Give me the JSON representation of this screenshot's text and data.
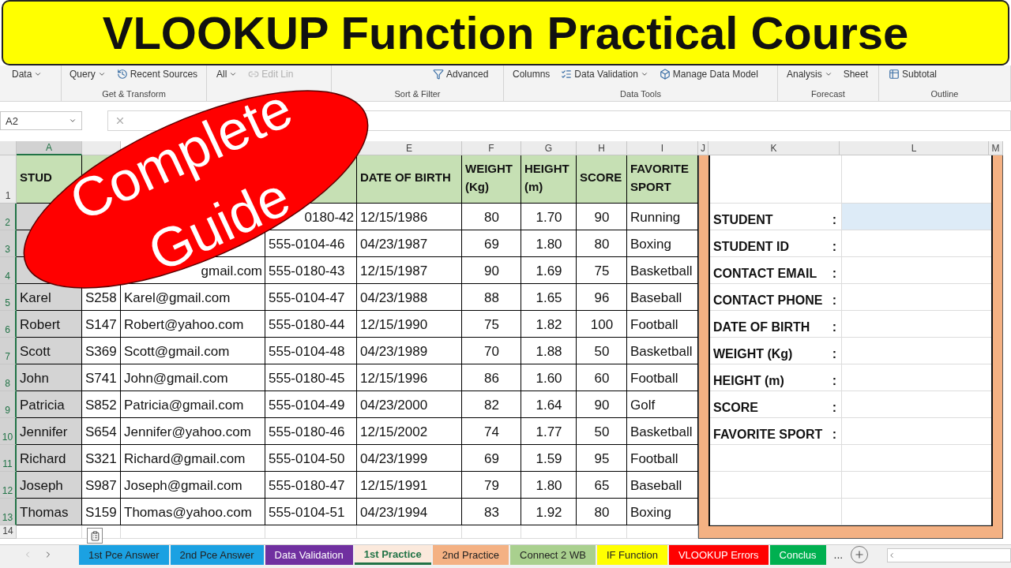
{
  "title": "VLOOKUP Function Practical Course",
  "ribbon": {
    "groups": [
      {
        "items": [
          {
            "label": "Data",
            "dropdown": true,
            "disabled": false
          }
        ]
      },
      {
        "label": "Get & Transform",
        "items": [
          {
            "label": "Query",
            "dropdown": true,
            "disabled": false
          },
          {
            "label": "Recent Sources",
            "dropdown": false,
            "disabled": false
          }
        ]
      },
      {
        "items": [
          {
            "label": "All",
            "dropdown": true,
            "disabled": false
          },
          {
            "label": "Edit Lin",
            "dropdown": false,
            "disabled": true
          }
        ]
      },
      {
        "label": "Sort & Filter",
        "items": [
          {
            "label": "Advanced",
            "dropdown": false,
            "disabled": false
          }
        ]
      },
      {
        "label": "Data Tools",
        "items": [
          {
            "label": "Columns",
            "dropdown": false,
            "disabled": false
          },
          {
            "label": "Data Validation",
            "dropdown": true,
            "disabled": false
          },
          {
            "label": "Manage Data Model",
            "dropdown": false,
            "disabled": false
          }
        ]
      },
      {
        "label": "Forecast",
        "items": [
          {
            "label": "Analysis",
            "dropdown": true,
            "disabled": false
          },
          {
            "label": "Sheet",
            "dropdown": false,
            "disabled": false
          }
        ]
      },
      {
        "label": "Outline",
        "items": [
          {
            "label": "Subtotal",
            "dropdown": false,
            "disabled": false
          }
        ]
      }
    ]
  },
  "name_box": "A2",
  "columns": [
    {
      "letter": "A",
      "selected": true
    },
    {
      "letter": "E",
      "selected": false
    },
    {
      "letter": "F",
      "selected": false
    },
    {
      "letter": "G",
      "selected": false
    },
    {
      "letter": "H",
      "selected": false
    },
    {
      "letter": "I",
      "selected": false
    },
    {
      "letter": "J",
      "selected": false
    },
    {
      "letter": "K",
      "selected": false
    },
    {
      "letter": "L",
      "selected": false
    },
    {
      "letter": "M",
      "selected": false
    }
  ],
  "rows": [
    {
      "number": "1",
      "selected": false,
      "cells": [
        "STUD",
        null,
        null,
        null,
        "DATE OF BIRTH",
        "WEIGHT (Kg)",
        "HEIGHT (m)",
        "SCORE",
        "FAVORITE SPORT"
      ]
    },
    {
      "number": "2",
      "selected": true,
      "cells": [
        null,
        null,
        null,
        {
          "text": "0180-42",
          "cut": true
        },
        "12/15/1986",
        "80",
        "1.70",
        "90",
        "Running"
      ]
    },
    {
      "number": "3",
      "selected": true,
      "cells": [
        null,
        null,
        null,
        "555-0104-46",
        "04/23/1987",
        "69",
        "1.80",
        "80",
        "Boxing"
      ]
    },
    {
      "number": "4",
      "selected": true,
      "cells": [
        null,
        null,
        {
          "text": "gmail.com",
          "cut": true
        },
        "555-0180-43",
        "12/15/1987",
        "90",
        "1.69",
        "75",
        "Basketball"
      ]
    },
    {
      "number": "5",
      "selected": true,
      "cells": [
        "Karel",
        "S258",
        "Karel@gmail.com",
        "555-0104-47",
        "04/23/1988",
        "88",
        "1.65",
        "96",
        "Baseball"
      ]
    },
    {
      "number": "6",
      "selected": true,
      "cells": [
        "Robert",
        "S147",
        "Robert@yahoo.com",
        "555-0180-44",
        "12/15/1990",
        "75",
        "1.82",
        "100",
        "Football"
      ]
    },
    {
      "number": "7",
      "selected": true,
      "cells": [
        "Scott",
        "S369",
        "Scott@gmail.com",
        "555-0104-48",
        "04/23/1989",
        "70",
        "1.88",
        "50",
        "Basketball"
      ]
    },
    {
      "number": "8",
      "selected": true,
      "cells": [
        "John",
        "S741",
        "John@gmail.com",
        "555-0180-45",
        "12/15/1996",
        "86",
        "1.60",
        "60",
        "Football"
      ]
    },
    {
      "number": "9",
      "selected": true,
      "cells": [
        "Patricia",
        "S852",
        "Patricia@gmail.com",
        "555-0104-49",
        "04/23/2000",
        "82",
        "1.64",
        "90",
        "Golf"
      ]
    },
    {
      "number": "10",
      "selected": true,
      "cells": [
        "Jennifer",
        "S654",
        "Jennifer@yahoo.com",
        "555-0180-46",
        "12/15/2002",
        "74",
        "1.77",
        "50",
        "Basketball"
      ]
    },
    {
      "number": "11",
      "selected": true,
      "cells": [
        "Richard",
        "S321",
        "Richard@gmail.com",
        "555-0104-50",
        "04/23/1999",
        "69",
        "1.59",
        "95",
        "Football"
      ]
    },
    {
      "number": "12",
      "selected": true,
      "cells": [
        "Joseph",
        "S987",
        "Joseph@gmail.com",
        "555-0180-47",
        "12/15/1991",
        "79",
        "1.80",
        "65",
        "Baseball"
      ]
    },
    {
      "number": "13",
      "selected": true,
      "cells": [
        "Thomas",
        "S159",
        "Thomas@yahoo.com",
        "555-0104-51",
        "04/23/1994",
        "83",
        "1.92",
        "80",
        "Boxing"
      ]
    },
    {
      "number": "14",
      "selected": false,
      "cells": []
    }
  ],
  "lookup_panel": {
    "rows": [
      {
        "label": "STUDENT",
        "separator": ":",
        "selected": true
      },
      {
        "label": "STUDENT ID",
        "separator": ":",
        "selected": false
      },
      {
        "label": "CONTACT EMAIL",
        "separator": ":",
        "selected": false
      },
      {
        "label": "CONTACT PHONE",
        "separator": ":",
        "selected": false
      },
      {
        "label": "DATE OF BIRTH",
        "separator": ":",
        "selected": false
      },
      {
        "label": "WEIGHT (Kg)",
        "separator": ":",
        "selected": false
      },
      {
        "label": "HEIGHT (m)",
        "separator": ":",
        "selected": false
      },
      {
        "label": "SCORE",
        "separator": ":",
        "selected": false
      },
      {
        "label": "FAVORITE SPORT",
        "separator": ":",
        "selected": false
      }
    ]
  },
  "sheet_tabs": [
    {
      "label": "1st Pce Answer",
      "color": "#1ba1e2",
      "selected": false
    },
    {
      "label": "2nd Pce Answer",
      "color": "#1ba1e2",
      "selected": false
    },
    {
      "label": "Data Validation",
      "color": "#7030a0",
      "selected": false
    },
    {
      "label": "1st Practice",
      "color": "#fbe9dc",
      "selected": true
    },
    {
      "label": "2nd Practice",
      "color": "#f4b183",
      "selected": false
    },
    {
      "label": "Connect 2 WB",
      "color": "#a9d08e",
      "selected": false
    },
    {
      "label": "IF Function",
      "color": "#ffff00",
      "selected": false
    },
    {
      "label": "VLOOKUP Errors",
      "color": "#ff0000",
      "selected": false
    },
    {
      "label": "Conclus",
      "color": "#00b050",
      "selected": false
    }
  ],
  "more_tabs": "...",
  "sticker": {
    "lines": [
      "Complete",
      "Guide"
    ]
  }
}
